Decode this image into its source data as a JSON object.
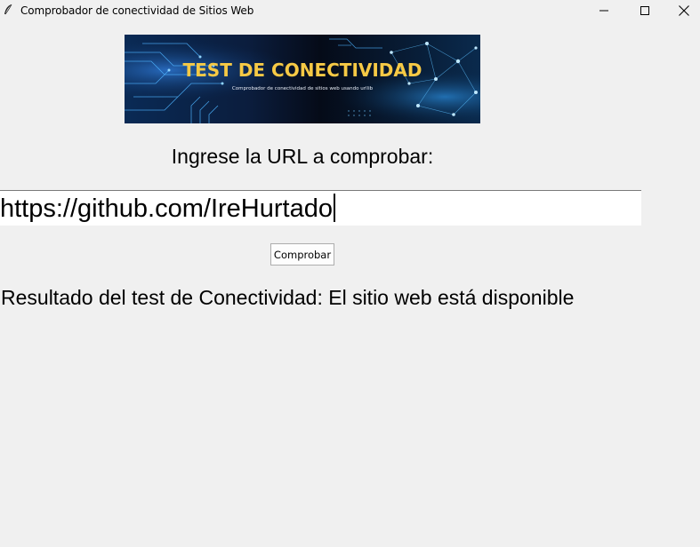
{
  "window": {
    "title": "Comprobador de conectividad de Sitios Web",
    "controls": [
      "minimize",
      "maximize",
      "close"
    ]
  },
  "banner": {
    "title": "TEST DE CONECTIVIDAD",
    "subtitle": "Comprobador de conectividad de sitios web usando urllib",
    "colors": {
      "background": "#0b1a33",
      "title": "#f6c945",
      "lines": "#3aa9ff"
    }
  },
  "form": {
    "prompt": "Ingrese la URL a comprobar:",
    "url_value": "https://github.com/IreHurtado",
    "check_button": "Comprobar"
  },
  "result": {
    "text": "Resultado del test de Conectividad: El sitio web está disponible"
  }
}
